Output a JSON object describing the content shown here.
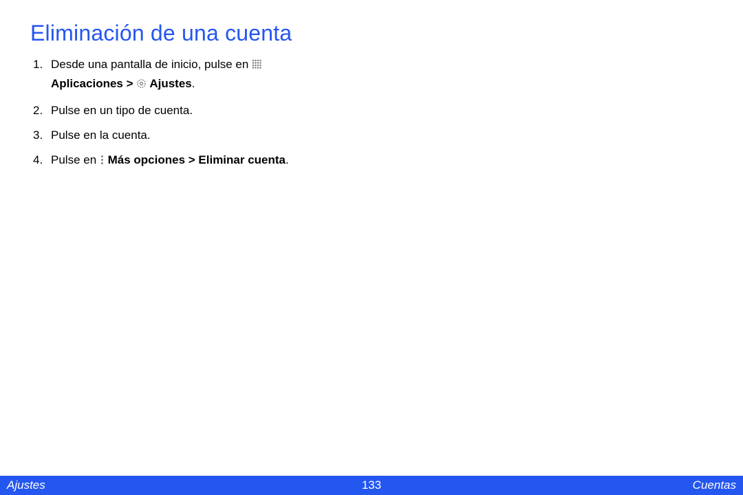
{
  "title": "Eliminación de una cuenta",
  "steps": {
    "s1": {
      "num": "1.",
      "part1": "Desde una pantalla de inicio, pulse en ",
      "bold1": "Aplicaciones > ",
      "bold2": " Ajustes",
      "period": "."
    },
    "s2": {
      "num": "2.",
      "text": "Pulse en un tipo de cuenta."
    },
    "s3": {
      "num": "3.",
      "text": "Pulse en la cuenta."
    },
    "s4": {
      "num": "4.",
      "part1": "Pulse en ",
      "bold": " Más opciones > Eliminar cuenta",
      "period": "."
    }
  },
  "footer": {
    "left": "Ajustes",
    "page": "133",
    "right": "Cuentas"
  }
}
